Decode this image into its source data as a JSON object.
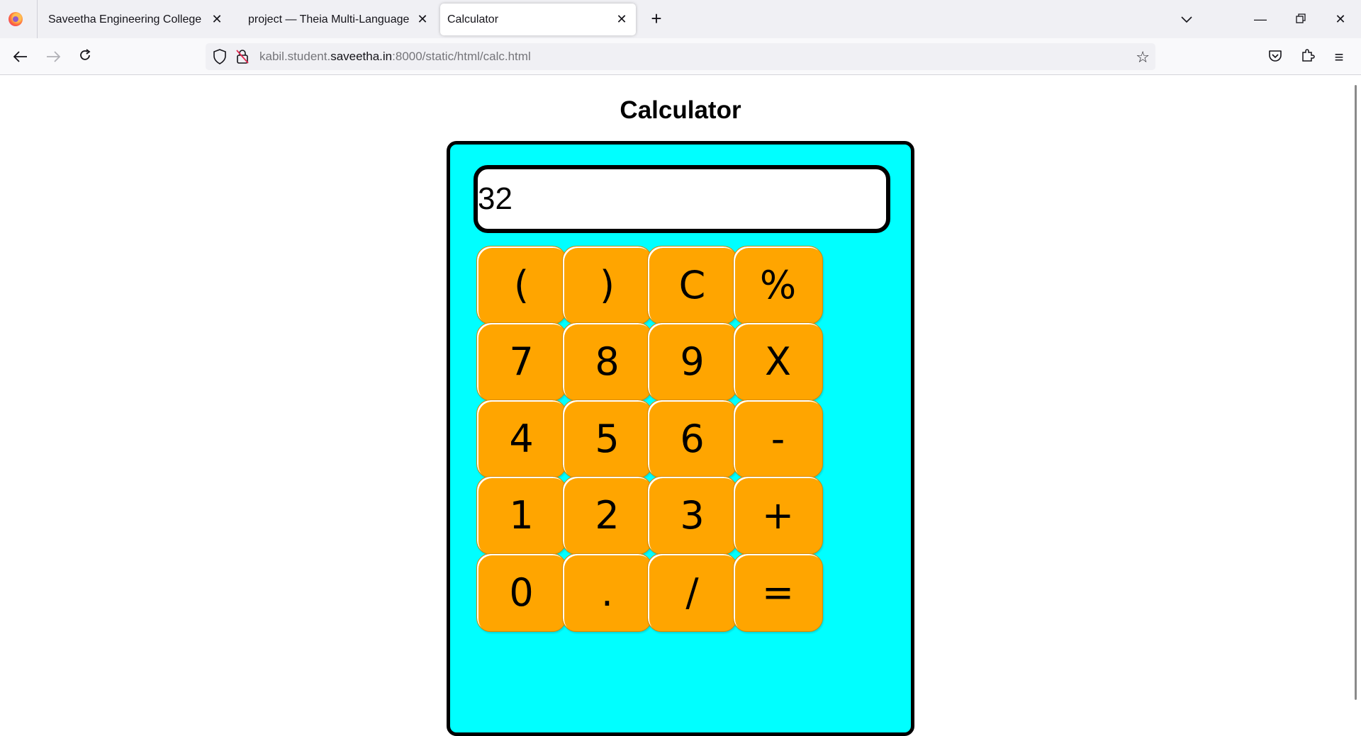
{
  "browser": {
    "tabs": [
      {
        "title": "Saveetha Engineering College"
      },
      {
        "title": "project — Theia Multi-Language Ex"
      },
      {
        "title": "Calculator"
      }
    ],
    "url": {
      "prefix": "kabil.student.",
      "host": "saveetha.in",
      "suffix": ":8000/static/html/calc.html"
    }
  },
  "page": {
    "title": "Calculator"
  },
  "calculator": {
    "display_value": "32",
    "keys": [
      [
        "(",
        ")",
        "C",
        "%"
      ],
      [
        "7",
        "8",
        "9",
        "X"
      ],
      [
        "4",
        "5",
        "6",
        "-"
      ],
      [
        "1",
        "2",
        "3",
        "+"
      ],
      [
        "0",
        ".",
        "/",
        "="
      ]
    ],
    "colors": {
      "body": "#00ffff",
      "key": "#ffa500",
      "display": "#ffffff",
      "border": "#000000"
    }
  }
}
